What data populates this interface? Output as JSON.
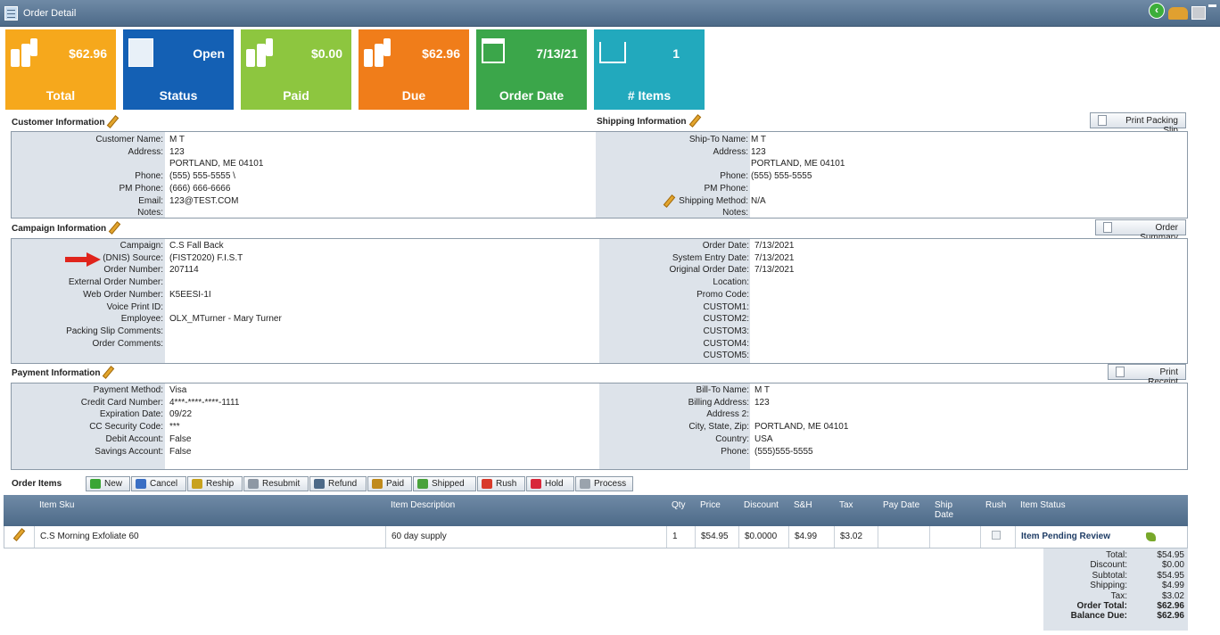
{
  "window": {
    "title": "Order Detail"
  },
  "tiles": [
    {
      "value": "$62.96",
      "label": "Total",
      "color": "#f6a81c",
      "icon": "money-stack-icon"
    },
    {
      "value": "Open",
      "label": "Status",
      "color": "#1460b4",
      "icon": "list-sheet-icon"
    },
    {
      "value": "$0.00",
      "label": "Paid",
      "color": "#8dc63f",
      "icon": "money-stack-icon"
    },
    {
      "value": "$62.96",
      "label": "Due",
      "color": "#f07d1a",
      "icon": "money-stack-icon"
    },
    {
      "value": "7/13/21",
      "label": "Order Date",
      "color": "#3ba64a",
      "icon": "calendar-icon"
    },
    {
      "value": "1",
      "label": "# Items",
      "color": "#22a9bd",
      "icon": "shopping-cart-icon"
    }
  ],
  "customer": {
    "title": "Customer Information",
    "rows": [
      {
        "k": "Customer Name:",
        "v": "M T"
      },
      {
        "k": "Address:",
        "v": "123"
      },
      {
        "k": "",
        "v": "PORTLAND, ME 04101"
      },
      {
        "k": "Phone:",
        "v": "(555) 555-5555 \\"
      },
      {
        "k": "PM Phone:",
        "v": "(666) 666-6666"
      },
      {
        "k": "Email:",
        "v": "123@TEST.COM"
      },
      {
        "k": "Notes:",
        "v": ""
      }
    ]
  },
  "shipping": {
    "title": "Shipping Information",
    "button": "Print Packing Slip",
    "rows": [
      {
        "k": "Ship-To Name:",
        "v": "M T"
      },
      {
        "k": "Address:",
        "v": "123"
      },
      {
        "k": "",
        "v": "PORTLAND, ME 04101"
      },
      {
        "k": "Phone:",
        "v": "(555) 555-5555"
      },
      {
        "k": "PM Phone:",
        "v": ""
      },
      {
        "k": "Shipping Method:",
        "v": "N/A"
      },
      {
        "k": "Notes:",
        "v": ""
      }
    ]
  },
  "campaign": {
    "title": "Campaign Information",
    "button": "Order Summary",
    "left": [
      {
        "k": "Campaign:",
        "v": "C.S Fall Back"
      },
      {
        "k": "(DNIS) Source:",
        "v": "(FIST2020) F.I.S.T"
      },
      {
        "k": "Order Number:",
        "v": "207114"
      },
      {
        "k": "External Order Number:",
        "v": ""
      },
      {
        "k": "Web Order Number:",
        "v": "K5EESI-1I"
      },
      {
        "k": "Voice Print ID:",
        "v": ""
      },
      {
        "k": "Employee:",
        "v": "OLX_MTurner - Mary Turner"
      },
      {
        "k": "Packing Slip Comments:",
        "v": ""
      },
      {
        "k": "Order Comments:",
        "v": ""
      }
    ],
    "right": [
      {
        "k": "Order Date:",
        "v": "7/13/2021"
      },
      {
        "k": "System Entry Date:",
        "v": "7/13/2021"
      },
      {
        "k": "Original Order Date:",
        "v": "7/13/2021"
      },
      {
        "k": "Location:",
        "v": ""
      },
      {
        "k": "Promo Code:",
        "v": ""
      },
      {
        "k": "CUSTOM1:",
        "v": ""
      },
      {
        "k": "CUSTOM2:",
        "v": ""
      },
      {
        "k": "CUSTOM3:",
        "v": ""
      },
      {
        "k": "CUSTOM4:",
        "v": ""
      },
      {
        "k": "CUSTOM5:",
        "v": ""
      }
    ]
  },
  "payment": {
    "title": "Payment Information",
    "button": "Print Receipt",
    "left": [
      {
        "k": "Payment Method:",
        "v": "Visa"
      },
      {
        "k": "Credit Card Number:",
        "v": "4***-****-****-1111"
      },
      {
        "k": "Expiration Date:",
        "v": "09/22"
      },
      {
        "k": "CC Security Code:",
        "v": "***"
      },
      {
        "k": "Debit Account:",
        "v": "False"
      },
      {
        "k": "Savings Account:",
        "v": "False"
      }
    ],
    "right": [
      {
        "k": "Bill-To Name:",
        "v": "M T"
      },
      {
        "k": "Billing Address:",
        "v": "123"
      },
      {
        "k": "Address 2:",
        "v": ""
      },
      {
        "k": "City, State, Zip:",
        "v": "PORTLAND, ME 04101"
      },
      {
        "k": "Country:",
        "v": "USA"
      },
      {
        "k": "Phone:",
        "v": "(555)555-5555"
      }
    ]
  },
  "order_items": {
    "title": "Order Items",
    "buttons": [
      {
        "label": "New",
        "icon": "plus-icon",
        "color": "#3aa535"
      },
      {
        "label": "Cancel",
        "icon": "cancel-icon",
        "color": "#3a6fc4"
      },
      {
        "label": "Reship",
        "icon": "reship-icon",
        "color": "#c8a21e"
      },
      {
        "label": "Resubmit",
        "icon": "resubmit-icon",
        "color": "#8e98a4"
      },
      {
        "label": "Refund",
        "icon": "refund-icon",
        "color": "#4d6a88"
      },
      {
        "label": "Paid",
        "icon": "paid-icon",
        "color": "#c08a1c"
      },
      {
        "label": "Shipped",
        "icon": "shipped-icon",
        "color": "#4aa23c"
      },
      {
        "label": "Rush",
        "icon": "rush-icon",
        "color": "#d83a2a"
      },
      {
        "label": "Hold",
        "icon": "hold-flag-icon",
        "color": "#d8283a"
      },
      {
        "label": "Process",
        "icon": "process-icon",
        "color": "#9aa3ad"
      }
    ],
    "columns": [
      "Item Sku",
      "Item Description",
      "Qty",
      "Price",
      "Discount",
      "S&H",
      "Tax",
      "Pay Date",
      "Ship Date",
      "Rush",
      "Item Status"
    ],
    "rows": [
      {
        "sku": "C.S Morning Exfoliate 60",
        "desc": "60 day supply",
        "qty": "1",
        "price": "$54.95",
        "discount": "$0.0000",
        "sh": "$4.99",
        "tax": "$3.02",
        "pay_date": "",
        "ship_date": "",
        "rush": false,
        "status": "Item Pending Review"
      }
    ]
  },
  "totals": [
    {
      "k": "Total:",
      "v": "$54.95",
      "bold": false
    },
    {
      "k": "Discount:",
      "v": "$0.00",
      "bold": false
    },
    {
      "k": "Subtotal:",
      "v": "$54.95",
      "bold": false
    },
    {
      "k": "Shipping:",
      "v": "$4.99",
      "bold": false
    },
    {
      "k": "Tax:",
      "v": "$3.02",
      "bold": false
    },
    {
      "k": "Order Total:",
      "v": "$62.96",
      "bold": true
    },
    {
      "k": "Balance Due:",
      "v": "$62.96",
      "bold": true
    }
  ]
}
